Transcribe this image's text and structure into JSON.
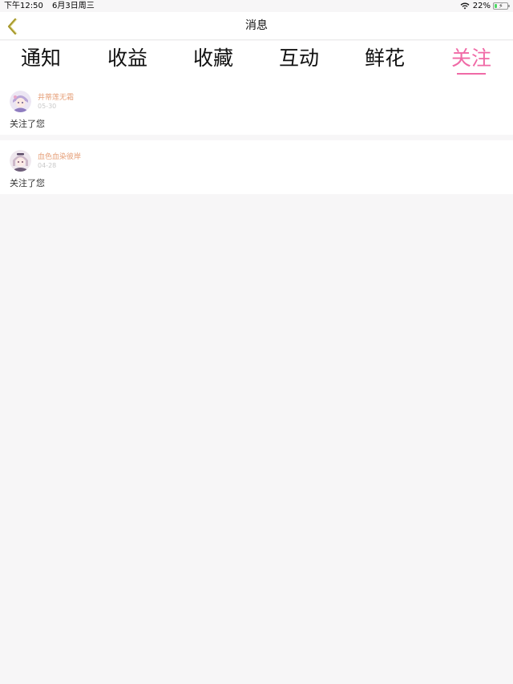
{
  "status_bar": {
    "time": "下午12:50",
    "date": "6月3日周三",
    "battery_percent_text": "22%",
    "battery_level": 0.22
  },
  "nav": {
    "title": "消息",
    "back_icon": "chevron-left-icon",
    "back_color": "#a89a2e"
  },
  "tabs": [
    {
      "label": "通知",
      "active": false
    },
    {
      "label": "收益",
      "active": false
    },
    {
      "label": "收藏",
      "active": false
    },
    {
      "label": "互动",
      "active": false
    },
    {
      "label": "鲜花",
      "active": false
    },
    {
      "label": "关注",
      "active": true
    }
  ],
  "colors": {
    "accent": "#f06aa6",
    "username": "#e6a07a",
    "date": "#c9c9c9",
    "background": "#f7f6f7"
  },
  "items": [
    {
      "user": "井蒂莲无霜",
      "date": "05-30",
      "text": "关注了您"
    },
    {
      "user": "血色血染彼岸",
      "date": "04-28",
      "text": "关注了您"
    }
  ]
}
